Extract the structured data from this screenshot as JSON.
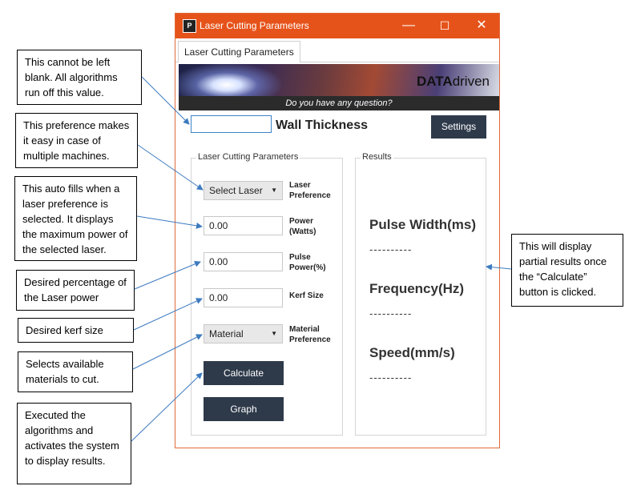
{
  "window": {
    "title": "Laser Cutting Parameters",
    "icon_glyph": "P",
    "controls": {
      "minimize": "—",
      "maximize": "☐",
      "close": "✕"
    }
  },
  "tab": {
    "label": "Laser Cutting Parameters"
  },
  "banner": {
    "brand_bold": "DATA",
    "brand_rest": "driven",
    "tagline": "Do you have any question?"
  },
  "wall_thickness": {
    "value": "",
    "label": "Wall Thickness"
  },
  "settings_button": "Settings",
  "params": {
    "group_title": "Laser Cutting Parameters",
    "laser_select": {
      "value": "Select Laser",
      "label_1": "Laser",
      "label_2": "Preference"
    },
    "power": {
      "value": "0.00",
      "label_1": "Power",
      "label_2": "(Watts)"
    },
    "pulse_power": {
      "value": "0.00",
      "label_1": "Pulse",
      "label_2": "Power(%)"
    },
    "kerf": {
      "value": "0.00",
      "label_1": "Kerf Size"
    },
    "material_select": {
      "value": "Material",
      "label_1": "Material",
      "label_2": "Preference"
    },
    "calculate_button": "Calculate",
    "graph_button": "Graph"
  },
  "results": {
    "group_title": "Results",
    "pulse_width": {
      "label": "Pulse Width(ms)",
      "value": "----------"
    },
    "frequency": {
      "label": "Frequency(Hz)",
      "value": "----------"
    },
    "speed": {
      "label": "Speed(mm/s)",
      "value": "----------"
    }
  },
  "callouts": {
    "wall": "This cannot be left blank. All algorithms run off this value.",
    "laser": "This preference makes it easy in case of multiple machines.",
    "power": "This auto fills when a laser preference is selected. It displays the maximum power of the selected laser.",
    "pulse": "Desired percentage of the Laser power",
    "kerf": "Desired kerf size",
    "material": "Selects available materials to cut.",
    "calculate": "Executed the algorithms and activates the system to display results.",
    "results": "This will display partial results once the “Calculate” button is clicked."
  },
  "colors": {
    "title_bar": "#e6531a",
    "dark_button": "#2e3a4a",
    "arrow": "#3c7bc0"
  }
}
